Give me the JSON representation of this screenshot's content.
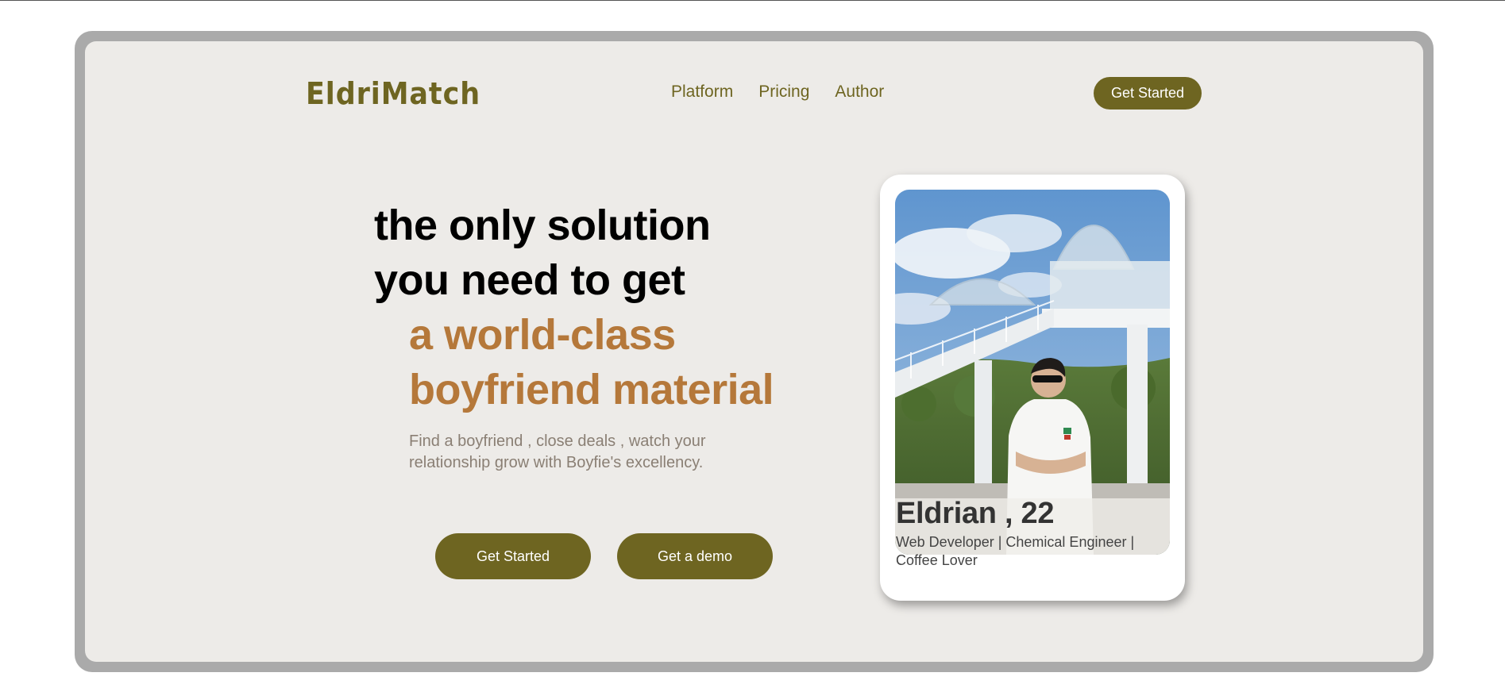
{
  "brand": {
    "logo_text": "EldriMatch",
    "accent_color": "#6e6521",
    "highlight_color": "#b5783a"
  },
  "nav": {
    "links": [
      {
        "label": "Platform"
      },
      {
        "label": "Pricing"
      },
      {
        "label": "Author"
      }
    ],
    "cta_label": "Get Started"
  },
  "hero": {
    "headline_line1": "the only solution",
    "headline_line2": "you need to get",
    "highlight_line1": "a world-class",
    "highlight_line2": "boyfriend material",
    "subtext_line1": "Find a boyfriend , close deals , watch your",
    "subtext_line2": "relationship grow with Boyfie's excellency.",
    "primary_button": "Get Started",
    "secondary_button": "Get a demo"
  },
  "profile_card": {
    "name": "Eldrian , 22",
    "bio": "Web Developer | Chemical Engineer | Coffee Lover"
  }
}
